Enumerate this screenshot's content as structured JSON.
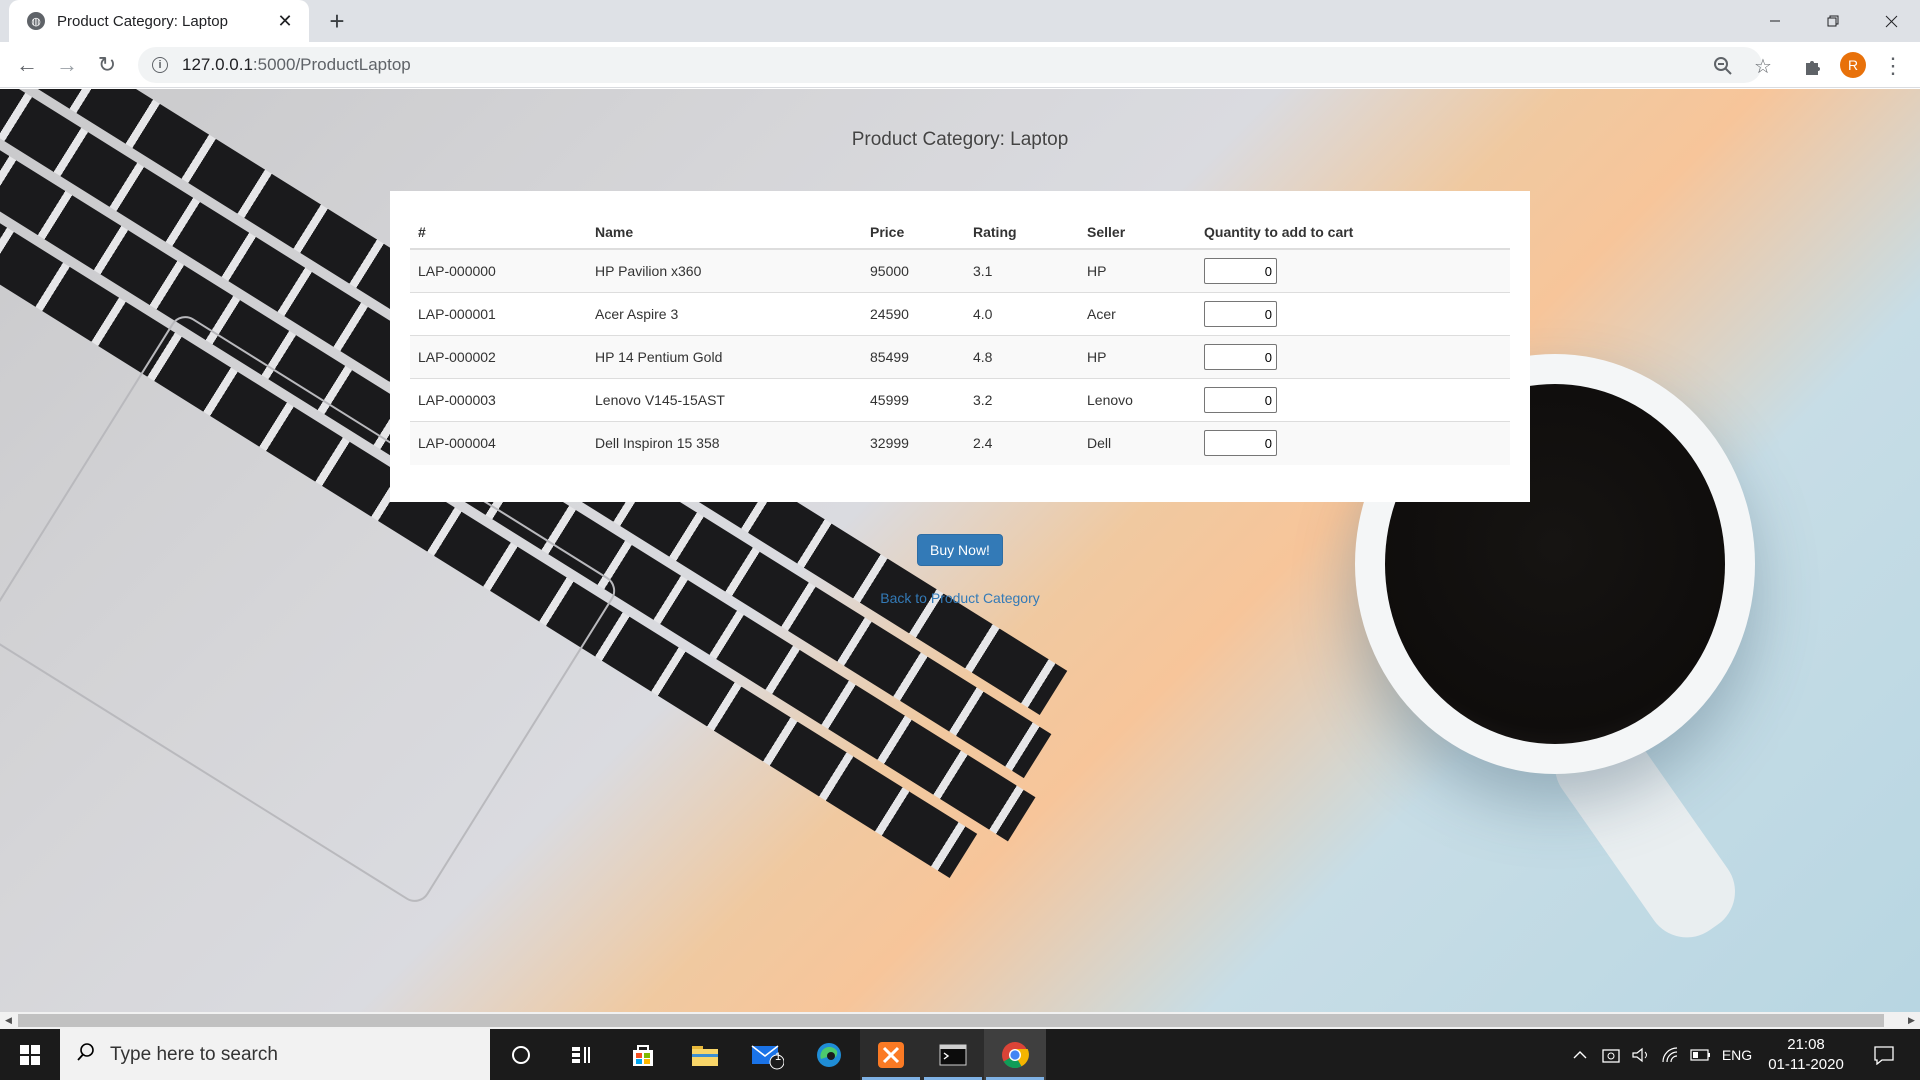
{
  "browser": {
    "tab_title": "Product Category: Laptop",
    "new_tab": "+",
    "tab_close": "✕",
    "url_host": "127.0.0.1",
    "url_path": ":5000/ProductLaptop",
    "profile_initial": "R"
  },
  "page": {
    "title": "Product Category: Laptop",
    "table": {
      "headers": [
        "#",
        "Name",
        "Price",
        "Rating",
        "Seller",
        "Quantity to add to cart"
      ],
      "rows": [
        {
          "id": "LAP-000000",
          "name": "HP Pavilion x360",
          "price": "95000",
          "rating": "3.1",
          "seller": "HP",
          "qty": "0"
        },
        {
          "id": "LAP-000001",
          "name": "Acer Aspire 3",
          "price": "24590",
          "rating": "4.0",
          "seller": "Acer",
          "qty": "0"
        },
        {
          "id": "LAP-000002",
          "name": "HP 14 Pentium Gold",
          "price": "85499",
          "rating": "4.8",
          "seller": "HP",
          "qty": "0"
        },
        {
          "id": "LAP-000003",
          "name": "Lenovo V145-15AST",
          "price": "45999",
          "rating": "3.2",
          "seller": "Lenovo",
          "qty": "0"
        },
        {
          "id": "LAP-000004",
          "name": "Dell Inspiron 15 358",
          "price": "32999",
          "rating": "2.4",
          "seller": "Dell",
          "qty": "0"
        }
      ]
    },
    "buy_button": "Buy Now!",
    "back_link": "Back to Product Category"
  },
  "taskbar": {
    "search_placeholder": "Type here to search",
    "mail_badge": "1",
    "language": "ENG",
    "time": "21:08",
    "date": "01-11-2020"
  },
  "colors": {
    "link": "#337ab7",
    "button": "#337ab7",
    "taskbar": "#1b1b1b",
    "avatar": "#e8710a"
  }
}
